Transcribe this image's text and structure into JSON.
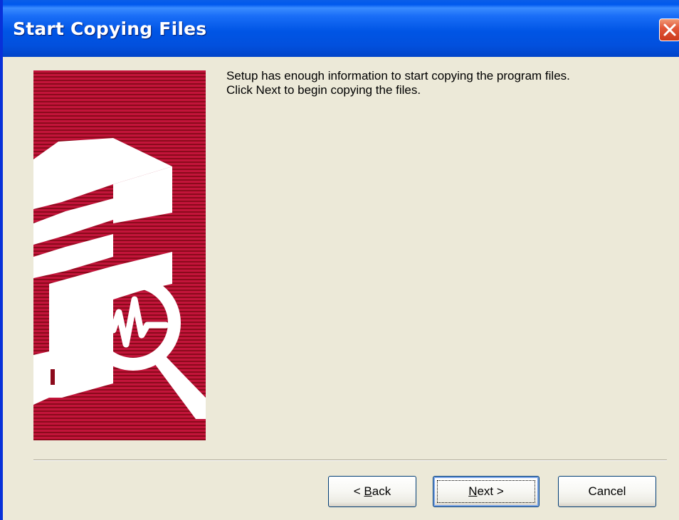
{
  "window": {
    "title": "Start Copying Files"
  },
  "instructions": {
    "line1": "Setup has enough information to start copying the program files.",
    "line2": "Click Next to begin copying the files."
  },
  "buttons": {
    "back": {
      "prefix": "< ",
      "mnemonic": "B",
      "rest": "ack"
    },
    "next": {
      "prefix": "",
      "mnemonic": "N",
      "rest": "ext >"
    },
    "cancel": "Cancel"
  },
  "colors": {
    "titlebar": "#0055e5",
    "banner_red": "#b20f27",
    "dialog_bg": "#ece9d8",
    "close_button": "#e2583a"
  },
  "icons": {
    "close": "close-icon",
    "banner": "server-magnifier-icon"
  }
}
